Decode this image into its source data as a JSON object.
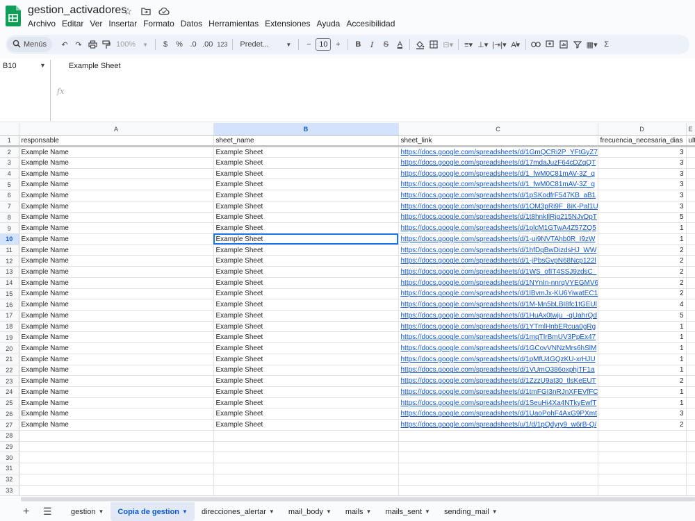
{
  "app": {
    "title": "gestion_activadores",
    "menu": [
      "Archivo",
      "Editar",
      "Ver",
      "Insertar",
      "Formato",
      "Datos",
      "Herramientas",
      "Extensiones",
      "Ayuda",
      "Accesibilidad"
    ]
  },
  "toolbar": {
    "search_label": "Menús",
    "zoom": "100%",
    "currency": "$",
    "percent": "%",
    "dec_decrease": ".0",
    "dec_increase": ".00",
    "number_format": "123",
    "font": "Predet...",
    "font_size": "10",
    "bold": "B",
    "italic": "I",
    "sum": "Σ"
  },
  "formula_bar": {
    "cell_ref": "B10",
    "content": "Example Sheet",
    "fx": "fx"
  },
  "grid": {
    "columns": [
      "A",
      "B",
      "C",
      "D",
      "E"
    ],
    "selected_column": "B",
    "selected_row": 10,
    "header_row": [
      "responsable",
      "sheet_name",
      "sheet_link",
      "frecuencia_necesaria_dias",
      "ult"
    ],
    "rows": [
      [
        "Example Name",
        "Example Sheet",
        "https://docs.google.com/spreadsheets/d/1GmQCRi2P_YFtGyZ7",
        "3"
      ],
      [
        "Example Name",
        "Example Sheet",
        "https://docs.google.com/spreadsheets/d/17mdaJuzF64cDZqQT",
        "3"
      ],
      [
        "Example Name",
        "Example Sheet",
        "https://docs.google.com/spreadsheets/d/1_fwM0C81mAV-3Z_q",
        "3"
      ],
      [
        "Example Name",
        "Example Sheet",
        "https://docs.google.com/spreadsheets/d/1_fwM0C81mAV-3Z_q",
        "3"
      ],
      [
        "Example Name",
        "Example Sheet",
        "https://docs.google.com/spreadsheets/d/1pSKodfrF547KB_aB1",
        "3"
      ],
      [
        "Example Name",
        "Example Sheet",
        "https://docs.google.com/spreadsheets/d/1OM3pRi9F_8iK-Pal1U",
        "3"
      ],
      [
        "Example Name",
        "Example Sheet",
        "https://docs.google.com/spreadsheets/d/1t8hnkIlRjg215NJvDpT",
        "5"
      ],
      [
        "Example Name",
        "Example Sheet",
        "https://docs.google.com/spreadsheets/d/1plcM1GTwA4Z57ZQ5",
        "1"
      ],
      [
        "Example Name",
        "Example Sheet",
        "https://docs.google.com/spreadsheets/d/1-ui9NVTAhb0R_I9zW",
        "1"
      ],
      [
        "Example Name",
        "Example Sheet",
        "https://docs.google.com/spreadsheets/d/1hfDqBwDizdsHJ_WW",
        "2"
      ],
      [
        "Example Name",
        "Example Sheet",
        "https://docs.google.com/spreadsheets/d/1-jPbsGvpN68Ncp122l",
        "2"
      ],
      [
        "Example Name",
        "Example Sheet",
        "https://docs.google.com/spreadsheets/d/1WS_ofIT4SSJ9zdsC_",
        "2"
      ],
      [
        "Example Name",
        "Example Sheet",
        "https://docs.google.com/spreadsheets/d/1NYnIn-nnrqVYEGMV6",
        "2"
      ],
      [
        "Example Name",
        "Example Sheet",
        "https://docs.google.com/spreadsheets/d/1lBvmJx-KU6YiwatEC1",
        "2"
      ],
      [
        "Example Name",
        "Example Sheet",
        "https://docs.google.com/spreadsheets/d/1M-Mn5bLBI8fc1tGEUl",
        "4"
      ],
      [
        "Example Name",
        "Example Sheet",
        "https://docs.google.com/spreadsheets/d/1HuAx0twju_-qUahrQd",
        "5"
      ],
      [
        "Example Name",
        "Example Sheet",
        "https://docs.google.com/spreadsheets/d/1YTmlHnbERcua0gRg",
        "1"
      ],
      [
        "Example Name",
        "Example Sheet",
        "https://docs.google.com/spreadsheets/d/1mqTIrBmUV3PpEx47",
        "1"
      ],
      [
        "Example Name",
        "Example Sheet",
        "https://docs.google.com/spreadsheets/d/1GCovVNNzMrs6hSlM",
        "1"
      ],
      [
        "Example Name",
        "Example Sheet",
        "https://docs.google.com/spreadsheets/d/1pMfU4GQzKU-xrHJU",
        "1"
      ],
      [
        "Example Name",
        "Example Sheet",
        "https://docs.google.com/spreadsheets/d/1VUmO386oxphjTF1a",
        "1"
      ],
      [
        "Example Name",
        "Example Sheet",
        "https://docs.google.com/spreadsheets/d/1ZzzU9at30_tlsKeEUT",
        "2"
      ],
      [
        "Example Name",
        "Example Sheet",
        "https://docs.google.com/spreadsheets/d/1tmFGI3nRJnXFEVfFC",
        "1"
      ],
      [
        "Example Name",
        "Example Sheet",
        "https://docs.google.com/spreadsheets/d/1SeuHi4Xa4NTkyEwfT",
        "1"
      ],
      [
        "Example Name",
        "Example Sheet",
        "https://docs.google.com/spreadsheets/d/1UaoPohF4AxG9PXmt",
        "3"
      ],
      [
        "Example Name",
        "Example Sheet",
        "https://docs.google.com/spreadsheets/u/1/d/1pQdyry9_w6rB-Q/",
        "2"
      ]
    ],
    "empty_rows": [
      28,
      29,
      30,
      31,
      32,
      33
    ]
  },
  "sheet_tabs": {
    "tabs": [
      "gestion",
      "Copia de gestion",
      "direcciones_alertar",
      "mail_body",
      "mails",
      "mails_sent",
      "sending_mail"
    ],
    "active": "Copia de gestion"
  },
  "colors": {
    "accent": "#0b57d0",
    "link": "#1155cc",
    "logo": "#0f9d58"
  }
}
